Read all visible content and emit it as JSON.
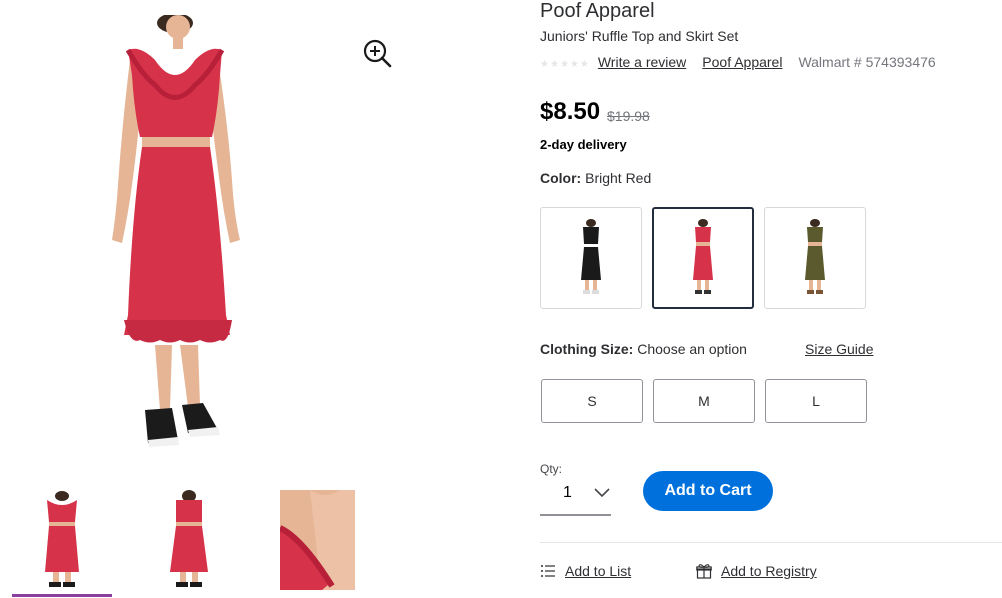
{
  "product": {
    "brand": "Poof Apparel",
    "name": "Juniors' Ruffle Top and Skirt Set",
    "rating_stars": 0,
    "write_review": "Write a review",
    "brand_link": "Poof Apparel",
    "item_number": "Walmart # 574393476",
    "price": "$8.50",
    "was_price": "$19.98",
    "delivery": "2-day delivery"
  },
  "color": {
    "label": "Color:",
    "selected": "Bright Red",
    "options": [
      {
        "name": "black",
        "hex": "#1a1a1a"
      },
      {
        "name": "bright-red",
        "hex": "#d6324a"
      },
      {
        "name": "olive",
        "hex": "#5a5a2e"
      }
    ]
  },
  "size": {
    "label": "Clothing Size:",
    "value": "Choose an option",
    "guide": "Size Guide",
    "options": [
      "S",
      "M",
      "L"
    ]
  },
  "qty": {
    "label": "Qty:",
    "value": "1"
  },
  "actions": {
    "add_to_cart": "Add to Cart",
    "add_to_list": "Add to List",
    "add_to_registry": "Add to Registry"
  },
  "colors": {
    "accent": "#0071dc",
    "dress_red": "#d6324a",
    "thumb_underline": "#8a3ea0"
  }
}
